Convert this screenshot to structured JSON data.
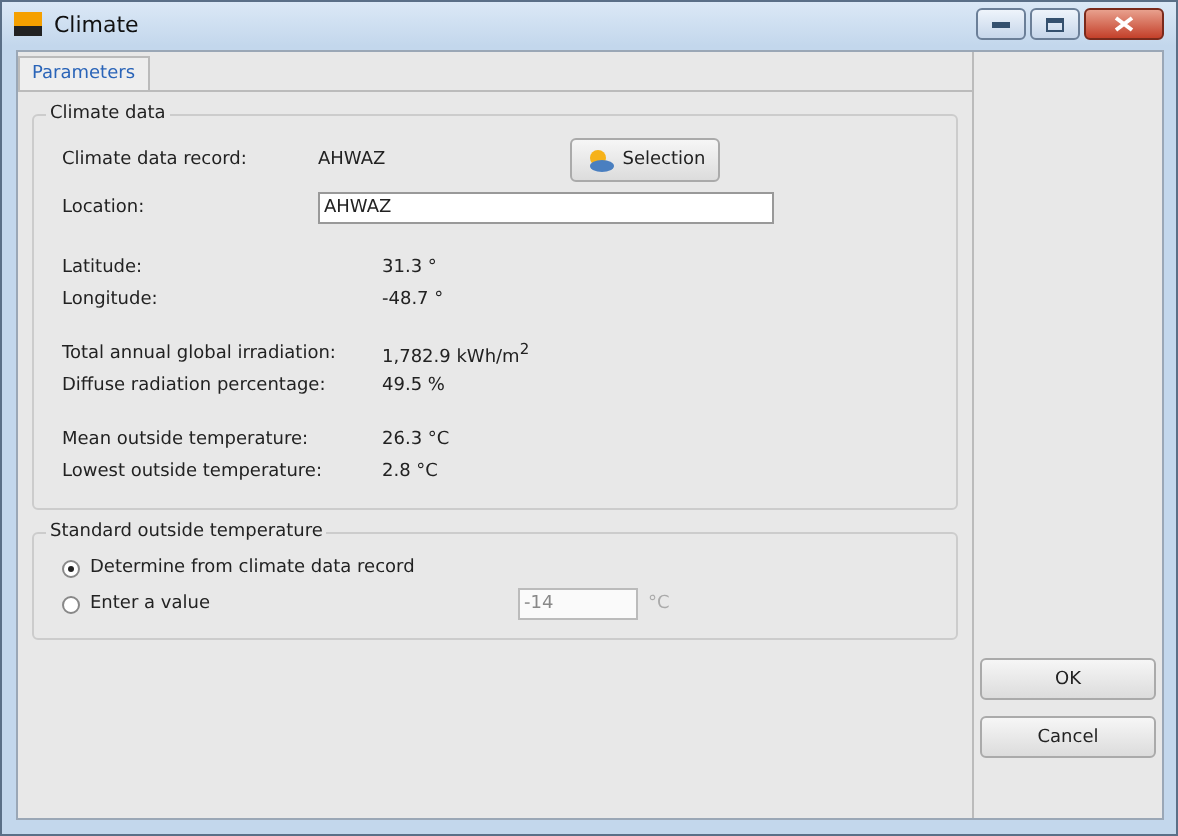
{
  "window": {
    "title": "Climate"
  },
  "tabs": [
    {
      "label": "Parameters",
      "selected": true
    }
  ],
  "climate_data": {
    "title": "Climate data",
    "record_label": "Climate data record:",
    "record_value": "AHWAZ",
    "selection_button": "Selection",
    "location_label": "Location:",
    "location_value": "AHWAZ",
    "groups": [
      [
        {
          "label": "Latitude:",
          "value": "31.3 °"
        },
        {
          "label": "Longitude:",
          "value": "-48.7 °"
        }
      ],
      [
        {
          "label": "Total annual global irradiation:",
          "value": "1,782.9 kWh/m$^{2}$"
        },
        {
          "label": "Diffuse radiation percentage:",
          "value": "49.5 %"
        }
      ],
      [
        {
          "label": "Mean outside temperature:",
          "value": "26.3 °C"
        },
        {
          "label": "Lowest outside temperature:",
          "value": "2.8 °C"
        }
      ]
    ]
  },
  "standard_temperature": {
    "title": "Standard outside temperature",
    "options": [
      {
        "label": "Determine from climate data record",
        "selected": true
      },
      {
        "label": "Enter a value",
        "selected": false
      }
    ],
    "value": "-14",
    "unit": "°C",
    "disabled": true
  },
  "buttons": [
    "OK",
    "Cancel"
  ]
}
